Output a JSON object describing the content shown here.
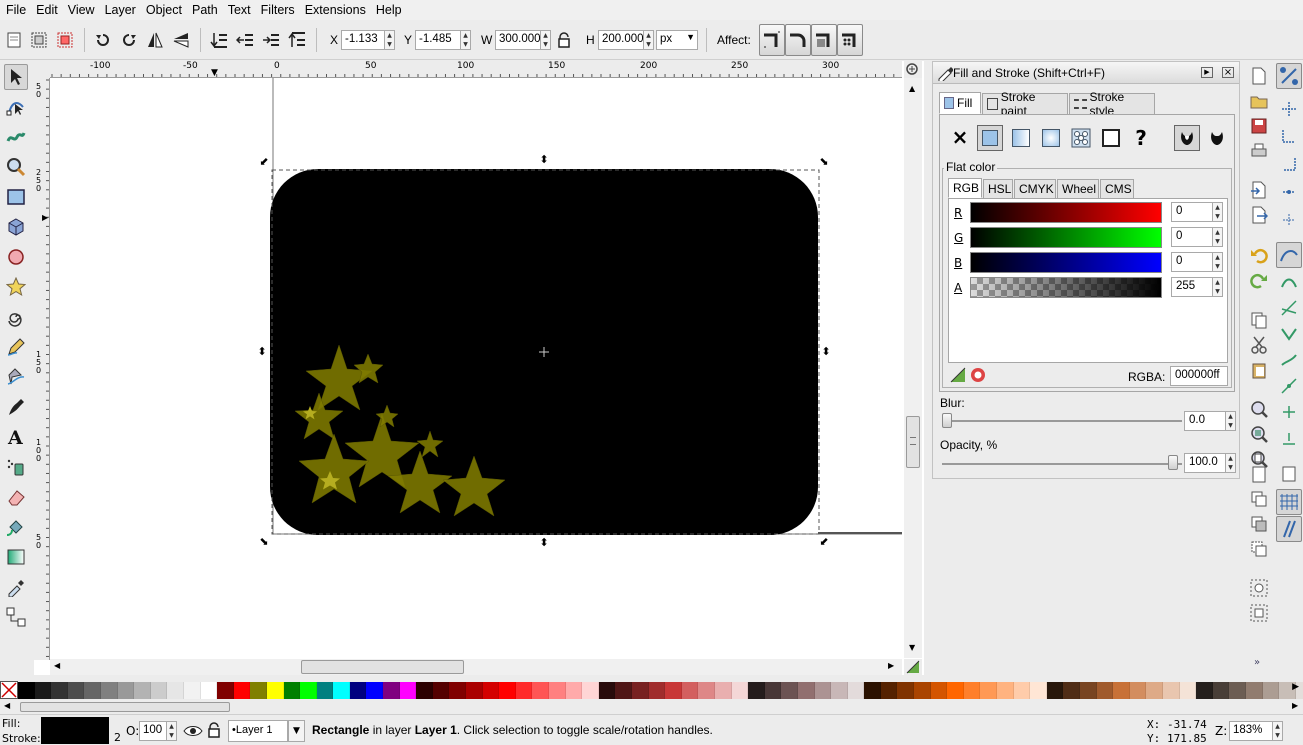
{
  "menu": [
    "File",
    "Edit",
    "View",
    "Layer",
    "Object",
    "Path",
    "Text",
    "Filters",
    "Extensions",
    "Help"
  ],
  "toolbar": {
    "x_label": "X",
    "x_value": "-1.133",
    "y_label": "Y",
    "y_value": "-1.485",
    "w_label": "W",
    "w_value": "300.000",
    "h_label": "H",
    "h_value": "200.000",
    "unit": "px",
    "affect_label": "Affect:"
  },
  "ruler": {
    "h_labels": [
      "-100",
      "-50",
      "0",
      "50",
      "100",
      "150",
      "200",
      "250",
      "300"
    ],
    "v_labels": [
      "5",
      "0",
      "2",
      "5",
      "0",
      "1",
      "5",
      "0",
      "1",
      "0",
      "0",
      "5",
      "0"
    ]
  },
  "panel": {
    "title": "Fill and Stroke (Shift+Ctrl+F)",
    "tabs": [
      "Fill",
      "Stroke paint",
      "Stroke style"
    ],
    "section_title": "Flat color",
    "color_tabs": [
      "RGB",
      "HSL",
      "CMYK",
      "Wheel",
      "CMS"
    ],
    "channels": [
      {
        "label": "R",
        "value": "0",
        "color": "#ff0000"
      },
      {
        "label": "G",
        "value": "0",
        "color": "#00ff00"
      },
      {
        "label": "B",
        "value": "0",
        "color": "#0000ff"
      },
      {
        "label": "A",
        "value": "255",
        "color": "#000000"
      }
    ],
    "rgba_label": "RGBA:",
    "rgba_value": "000000ff",
    "blur_label": "Blur:",
    "blur_value": "0.0",
    "opacity_label": "Opacity, %",
    "opacity_value": "100.0"
  },
  "status": {
    "fill_label": "Fill:",
    "stroke_label": "Stroke:",
    "stroke_width": "2",
    "opacity_label": "O:",
    "opacity_value": "100",
    "layer": "Layer 1",
    "message_bold": "Rectangle",
    "message_mid": " in layer ",
    "message_layer": "Layer 1",
    "message_rest": ". Click selection to toggle scale/rotation handles.",
    "x_label": "X:",
    "x_value": "-31.74",
    "y_label": "Y:",
    "y_value": "171.85",
    "z_label": "Z:",
    "zoom": "183%"
  },
  "colors": {
    "fill": "#000000",
    "stars": "#807b00",
    "accent": "#3c8fcf"
  },
  "palette": [
    "#000000",
    "#1a1a1a",
    "#333333",
    "#4d4d4d",
    "#666666",
    "#808080",
    "#999999",
    "#b3b3b3",
    "#cccccc",
    "#e6e6e6",
    "#f2f2f2",
    "#ffffff",
    "#800000",
    "#ff0000",
    "#808000",
    "#ffff00",
    "#008000",
    "#00ff00",
    "#008080",
    "#00ffff",
    "#000080",
    "#0000ff",
    "#800080",
    "#ff00ff",
    "#2b0000",
    "#550000",
    "#800000",
    "#aa0000",
    "#d40000",
    "#ff0000",
    "#ff2a2a",
    "#ff5555",
    "#ff8080",
    "#ffaaaa",
    "#ffd5d5",
    "#280b0b",
    "#501616",
    "#782121",
    "#a02c2c",
    "#c83737",
    "#d35f5f",
    "#de8787",
    "#e9afaf",
    "#f4d7d7",
    "#241c1c",
    "#483737",
    "#6c5353",
    "#916f6f",
    "#ac9393",
    "#c8b7b7",
    "#e3dbdb",
    "#2b1100",
    "#552200",
    "#803300",
    "#aa4400",
    "#d45500",
    "#ff6600",
    "#ff7f2a",
    "#ff9955",
    "#ffb380",
    "#ffccaa",
    "#ffe6d5",
    "#28170b",
    "#502d16",
    "#784421",
    "#a05a2c",
    "#c87137",
    "#d38d5f",
    "#deaa87",
    "#e9c6af",
    "#f4e3d7",
    "#241f1c",
    "#483e37",
    "#6c5d53",
    "#917c6f",
    "#ac9d93",
    "#c8beb7",
    "#e3dedb"
  ]
}
